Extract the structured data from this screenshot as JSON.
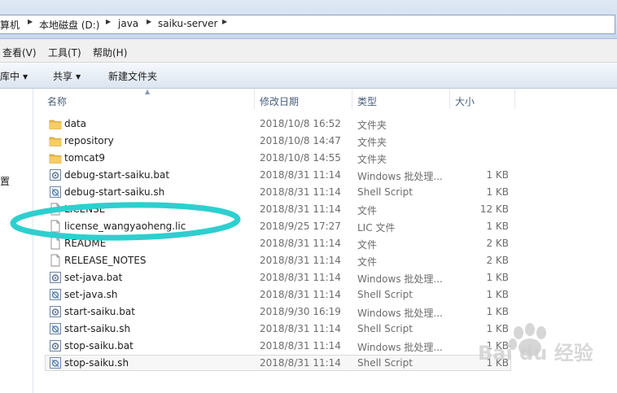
{
  "address": {
    "crumbs": [
      "算机",
      "本地磁盘 (D:)",
      "java",
      "saiku-server"
    ]
  },
  "menu": {
    "view": "查看(V)",
    "tools": "工具(T)",
    "help": "帮助(H)"
  },
  "toolbar": {
    "library": "库中",
    "share": "共享",
    "new_folder": "新建文件夹"
  },
  "nav": {
    "partial_label": "置"
  },
  "columns": {
    "name": "名称",
    "date": "修改日期",
    "type": "类型",
    "size": "大小"
  },
  "files": [
    {
      "name": "data",
      "date": "2018/10/8 16:52",
      "type": "文件夹",
      "size": "",
      "icon": "folder-icon"
    },
    {
      "name": "repository",
      "date": "2018/10/8 14:47",
      "type": "文件夹",
      "size": "",
      "icon": "folder-icon"
    },
    {
      "name": "tomcat9",
      "date": "2018/10/8 14:55",
      "type": "文件夹",
      "size": "",
      "icon": "folder-icon"
    },
    {
      "name": "debug-start-saiku.bat",
      "date": "2018/8/31 11:14",
      "type": "Windows 批处理...",
      "size": "1 KB",
      "icon": "batch-file-icon"
    },
    {
      "name": "debug-start-saiku.sh",
      "date": "2018/8/31 11:14",
      "type": "Shell Script",
      "size": "1 KB",
      "icon": "script-file-icon"
    },
    {
      "name": "LICENSE",
      "date": "2018/8/31 11:14",
      "type": "文件",
      "size": "12 KB",
      "icon": "file-icon"
    },
    {
      "name": "license_wangyaoheng.lic",
      "date": "2018/9/25 17:27",
      "type": "LIC 文件",
      "size": "1 KB",
      "icon": "file-icon"
    },
    {
      "name": "README",
      "date": "2018/8/31 11:14",
      "type": "文件",
      "size": "2 KB",
      "icon": "file-icon"
    },
    {
      "name": "RELEASE_NOTES",
      "date": "2018/8/31 11:14",
      "type": "文件",
      "size": "2 KB",
      "icon": "file-icon"
    },
    {
      "name": "set-java.bat",
      "date": "2018/8/31 11:14",
      "type": "Windows 批处理...",
      "size": "1 KB",
      "icon": "batch-file-icon"
    },
    {
      "name": "set-java.sh",
      "date": "2018/8/31 11:14",
      "type": "Shell Script",
      "size": "1 KB",
      "icon": "script-file-icon"
    },
    {
      "name": "start-saiku.bat",
      "date": "2018/9/30 16:19",
      "type": "Windows 批处理...",
      "size": "1 KB",
      "icon": "batch-file-icon"
    },
    {
      "name": "start-saiku.sh",
      "date": "2018/8/31 11:14",
      "type": "Shell Script",
      "size": "1 KB",
      "icon": "script-file-icon"
    },
    {
      "name": "stop-saiku.bat",
      "date": "2018/8/31 11:14",
      "type": "Windows 批处理...",
      "size": "1 KB",
      "icon": "batch-file-icon"
    },
    {
      "name": "stop-saiku.sh",
      "date": "2018/8/31 11:14",
      "type": "Shell Script",
      "size": "1 KB",
      "icon": "script-file-icon"
    }
  ],
  "selected_index": 14,
  "annotation_color": "#2ecfcf",
  "watermark": {
    "text": "Bai du 经验"
  }
}
